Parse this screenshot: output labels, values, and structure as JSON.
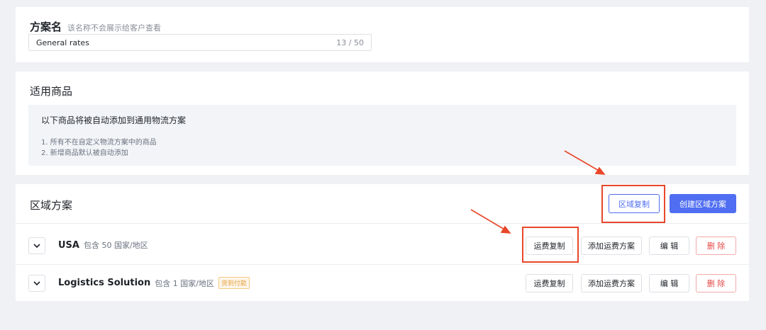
{
  "plan": {
    "title": "方案名",
    "hint": "该名称不会展示给客户查看",
    "input_value": "General rates",
    "char_count": "13 / 50"
  },
  "products": {
    "title": "适用商品",
    "info_heading": "以下商品将被自动添加到通用物流方案",
    "info_items": [
      "1. 所有不在自定义物流方案中的商品",
      "2. 新增商品默认被自动添加"
    ]
  },
  "regions": {
    "title": "区域方案",
    "region_copy_label": "区域复制",
    "create_label": "创建区域方案",
    "rows": [
      {
        "name": "USA",
        "count": "包含 50 国家/地区",
        "badge": "",
        "fee_copy": "运费复制",
        "add_fee": "添加运费方案",
        "edit": "编 辑",
        "delete": "删 除"
      },
      {
        "name": "Logistics Solution",
        "count": "包含 1 国家/地区",
        "badge": "货到付款",
        "fee_copy": "运费复制",
        "add_fee": "添加运费方案",
        "edit": "编 辑",
        "delete": "删 除"
      }
    ]
  },
  "colors": {
    "primary": "#4f6ef2",
    "annotation": "#e8472b",
    "danger": "#e54848",
    "badge": "#e6a23c"
  },
  "icons": [
    "chevron-down-icon",
    "annotation-arrow"
  ]
}
